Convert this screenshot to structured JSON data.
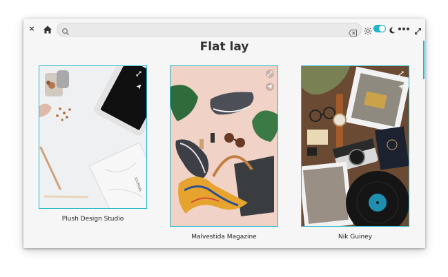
{
  "window": {
    "url_placeholder": "",
    "close_glyph": "×"
  },
  "page": {
    "title": "Flat lay"
  },
  "cards": [
    {
      "caption": "Plush Design Studio"
    },
    {
      "caption": "Malvestida Magazine"
    },
    {
      "caption": "Nik Guiney"
    }
  ],
  "colors": {
    "accent": "#1fb6c8",
    "background": "#f6f6f6",
    "text": "#333333"
  },
  "icons": [
    "close-icon",
    "home-icon",
    "search-icon",
    "clear-icon",
    "sun-icon",
    "moon-icon",
    "menu-icon",
    "maximize-icon",
    "expand-icon",
    "send-icon"
  ]
}
